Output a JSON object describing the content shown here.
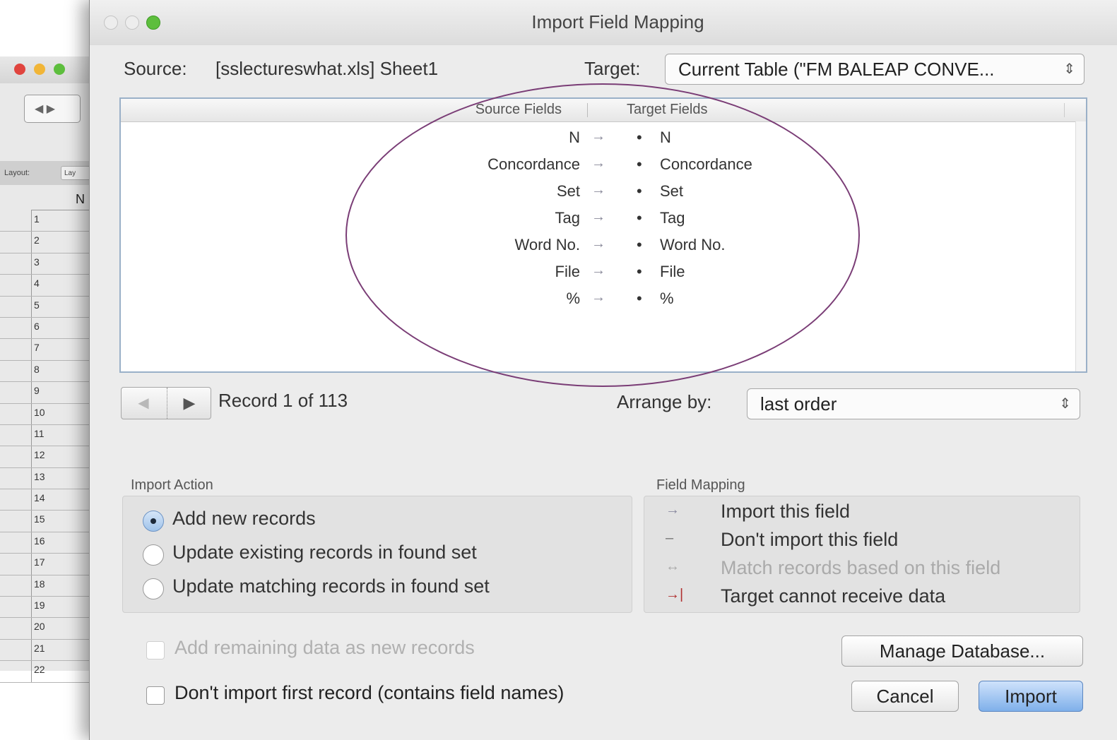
{
  "background_window": {
    "layout_label": "Layout:",
    "layout_value": "Lay",
    "column_header": "N",
    "row_numbers": [
      "1",
      "2",
      "3",
      "4",
      "5",
      "6",
      "7",
      "8",
      "9",
      "10",
      "11",
      "12",
      "13",
      "14",
      "15",
      "16",
      "17",
      "18",
      "19",
      "20",
      "21",
      "22"
    ]
  },
  "dialog": {
    "title": "Import Field Mapping",
    "source_label": "Source:",
    "source_value": "[sslectureswhat.xls] Sheet1",
    "target_label": "Target:",
    "target_value": "Current Table (\"FM BALEAP CONVE...",
    "table": {
      "header_source": "Source Fields",
      "header_target": "Target Fields",
      "rows": [
        {
          "source": "N",
          "arrow": "→",
          "target": "N"
        },
        {
          "source": "Concordance",
          "arrow": "→",
          "target": "Concordance"
        },
        {
          "source": "Set",
          "arrow": "→",
          "target": "Set"
        },
        {
          "source": "Tag",
          "arrow": "→",
          "target": "Tag"
        },
        {
          "source": "Word No.",
          "arrow": "→",
          "target": "Word No."
        },
        {
          "source": "File",
          "arrow": "→",
          "target": "File"
        },
        {
          "source": "%",
          "arrow": "→",
          "target": "%"
        }
      ]
    },
    "record_status": "Record 1 of 113",
    "arrange_label": "Arrange by:",
    "arrange_value": "last order",
    "import_action": {
      "title": "Import Action",
      "options": [
        {
          "label": "Add new records",
          "selected": true
        },
        {
          "label": "Update existing records in found set",
          "selected": false
        },
        {
          "label": "Update matching records in found set",
          "selected": false
        }
      ]
    },
    "field_mapping_legend": {
      "title": "Field Mapping",
      "items": [
        {
          "symbol": "→",
          "label": "Import this field"
        },
        {
          "symbol": "–",
          "label": "Don't import this field"
        },
        {
          "symbol": "↔",
          "label": "Match records based on this field"
        },
        {
          "symbol": "→|",
          "label": "Target cannot receive data"
        }
      ]
    },
    "add_remaining_label": "Add remaining data as new records",
    "dont_import_first_label": "Don't import first record (contains field names)",
    "manage_database_label": "Manage Database...",
    "cancel_label": "Cancel",
    "import_label": "Import"
  },
  "colors": {
    "annotation_ellipse": "#7a3d76",
    "close_light": "#e0443e",
    "minimize_light": "#f1b537",
    "zoom_light": "#5dbe3d",
    "default_button": "#7fb0ea"
  }
}
